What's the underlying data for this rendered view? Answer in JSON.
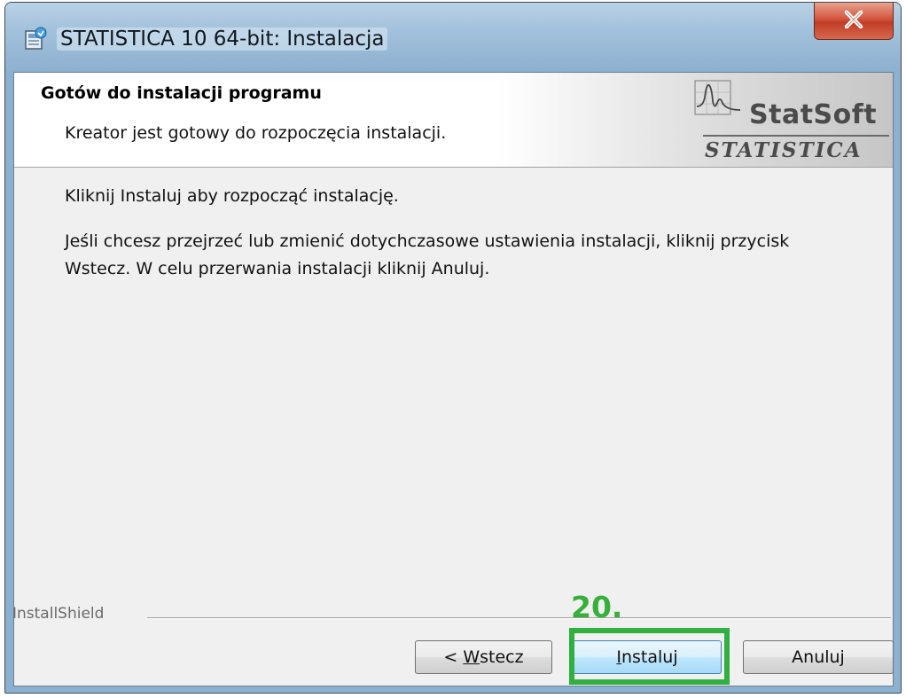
{
  "window": {
    "title": "STATISTICA 10 64-bit: Instalacja",
    "close_glyph": "✕"
  },
  "header": {
    "title": "Gotów do instalacji programu",
    "subtitle": "Kreator jest gotowy do rozpoczęcia instalacji.",
    "logo_top": "StatSoft",
    "logo_bottom": "STATISTICA"
  },
  "body": {
    "line1": "Kliknij Instaluj aby rozpocząć instalację.",
    "line2": "Jeśli chcesz przejrzeć lub zmienić dotychczasowe ustawienia instalacji, kliknij przycisk Wstecz. W celu przerwania instalacji kliknij Anuluj."
  },
  "footer": {
    "brand": "InstallShield"
  },
  "annotation": {
    "step": "20.",
    "color": "#2fb041"
  },
  "buttons": {
    "back_prefix": "< ",
    "back_mnemonic": "W",
    "back_rest": "stecz",
    "install_mnemonic": "I",
    "install_rest": "nstaluj",
    "cancel": "Anuluj"
  },
  "icons": {
    "app": "installer-icon",
    "close": "close-icon",
    "logo": "statsoft-chart-icon"
  }
}
